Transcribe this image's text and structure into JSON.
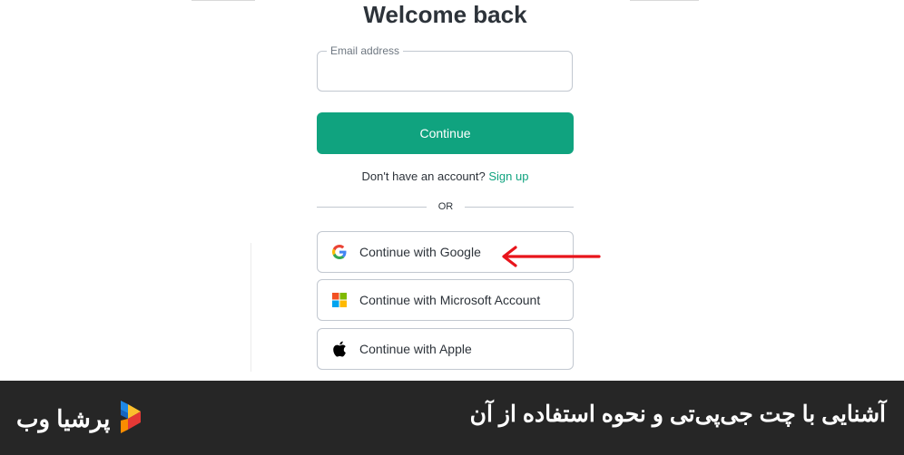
{
  "page": {
    "title": "Welcome back"
  },
  "email": {
    "label": "Email address",
    "value": "",
    "placeholder": ""
  },
  "continue_button": {
    "label": "Continue",
    "color": "#10a37f"
  },
  "signup": {
    "prompt": "Don't have an account?",
    "link": "Sign up"
  },
  "divider": {
    "text": "OR"
  },
  "social": [
    {
      "label": "Continue with Google",
      "icon": "google-icon"
    },
    {
      "label": "Continue with Microsoft Account",
      "icon": "microsoft-icon"
    },
    {
      "label": "Continue with Apple",
      "icon": "apple-icon"
    }
  ],
  "annotation": {
    "arrow_color": "#e8141b",
    "icon": "arrow-left-icon"
  },
  "footer": {
    "caption": "آشنایی با چت جی‌پی‌تی و نحوه استفاده از آن",
    "brand": "پرشیا وب",
    "background": "#262626"
  }
}
